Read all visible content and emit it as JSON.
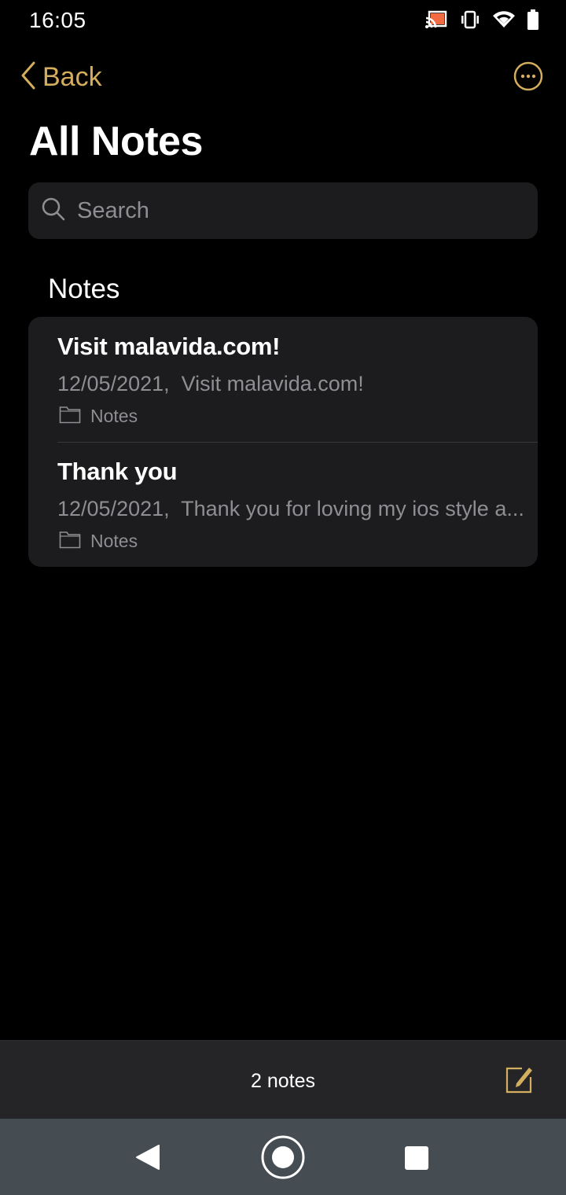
{
  "status_bar": {
    "time": "16:05",
    "icons": [
      "cast-icon",
      "vibrate-icon",
      "wifi-icon",
      "battery-icon"
    ],
    "cast_color": "#f26b43"
  },
  "nav": {
    "back_label": "Back",
    "more_icon": "ellipsis-circle-icon"
  },
  "accent_color": "#d4ad5e",
  "page_title": "All Notes",
  "search": {
    "placeholder": "Search",
    "value": ""
  },
  "section_header": "Notes",
  "notes": [
    {
      "title": "Visit malavida.com!",
      "date": "12/05/2021,",
      "preview": "Visit malavida.com!",
      "folder": "Notes"
    },
    {
      "title": "Thank you",
      "date": "12/05/2021,",
      "preview": "Thank you for loving my ios style a...",
      "folder": "Notes"
    }
  ],
  "toolbar": {
    "note_count": "2 notes",
    "compose_icon": "compose-icon"
  },
  "system_nav": {
    "buttons": [
      "back",
      "home",
      "recents"
    ]
  }
}
